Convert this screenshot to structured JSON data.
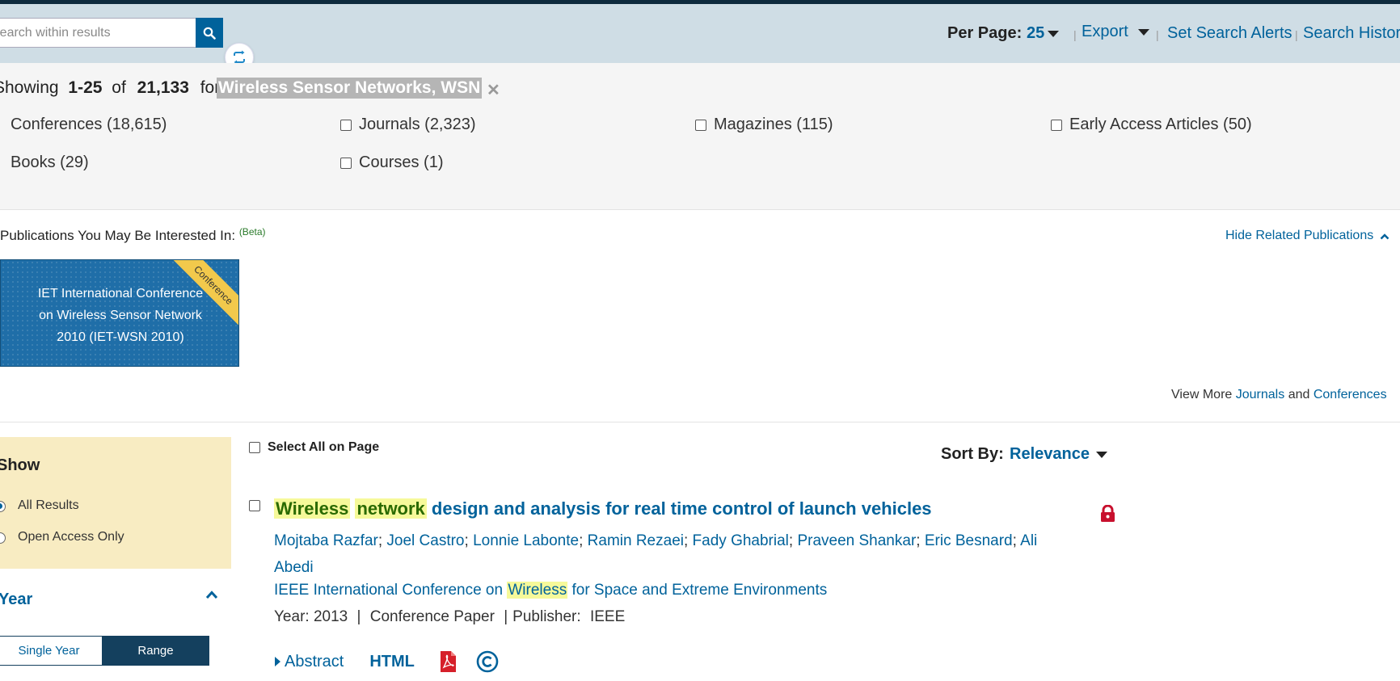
{
  "toolbar": {
    "search_placeholder": "Search within results",
    "per_page_label": "Per Page:",
    "per_page_value": "25",
    "export_label": "Export",
    "set_alerts_label": "Set Search Alerts",
    "history_label": "Search History",
    "separator": "|"
  },
  "results_summary": {
    "prefix": "Showing",
    "range": "1-25",
    "of": "of",
    "total": "21,133",
    "for": "for",
    "query": "Wireless Sensor Networks, WSN"
  },
  "content_types": [
    {
      "label": "Conferences (18,615)"
    },
    {
      "label": "Journals (2,323)"
    },
    {
      "label": "Magazines (115)"
    },
    {
      "label": "Early Access Articles (50)"
    },
    {
      "label": "Books (29)"
    },
    {
      "label": "Courses (1)"
    }
  ],
  "related_pubs": {
    "title": "Publications You May Be Interested In:",
    "beta": "(Beta)",
    "hide_label": "Hide Related Publications",
    "card_lines": [
      "IET International Conference",
      "on Wireless Sensor Network",
      "2010 (IET-WSN 2010)"
    ],
    "card_ribbon": "Conference",
    "view_more_prefix": "View More",
    "view_more_journals": "Journals",
    "view_more_and": "and",
    "view_more_conferences": "Conferences"
  },
  "sidebar": {
    "show_heading": "Show",
    "all_results": "All Results",
    "open_access": "Open Access Only",
    "year_heading": "Year",
    "tab_single": "Single Year",
    "tab_range": "Range"
  },
  "results_bar": {
    "select_all": "Select All on Page",
    "sort_by_label": "Sort By:",
    "sort_by_value": "Relevance"
  },
  "result": {
    "title_hl1": "Wireless",
    "title_hl2": "network",
    "title_rest": "design and analysis for real time control of launch vehicles",
    "authors": [
      "Mojtaba Razfar",
      "Joel Castro",
      "Lonnie Labonte",
      "Ramin Rezaei",
      "Fady Ghabrial",
      "Praveen Shankar",
      "Eric Besnard",
      "Ali Abedi"
    ],
    "venue_pre": "IEEE International Conference on",
    "venue_hl": "Wireless",
    "venue_post": "for Space and Extreme Environments",
    "year_label": "Year:",
    "year": "2013",
    "type": "Conference Paper",
    "publisher_label": "Publisher:",
    "publisher": "IEEE",
    "abstract_label": "Abstract",
    "html_label": "HTML"
  },
  "colors": {
    "brand_blue": "#00629b",
    "toolbar_bg": "#cfdde5",
    "highlight": "#f6f99a",
    "show_panel_bg": "#f8ecc2",
    "lock_red": "#c8102e"
  }
}
